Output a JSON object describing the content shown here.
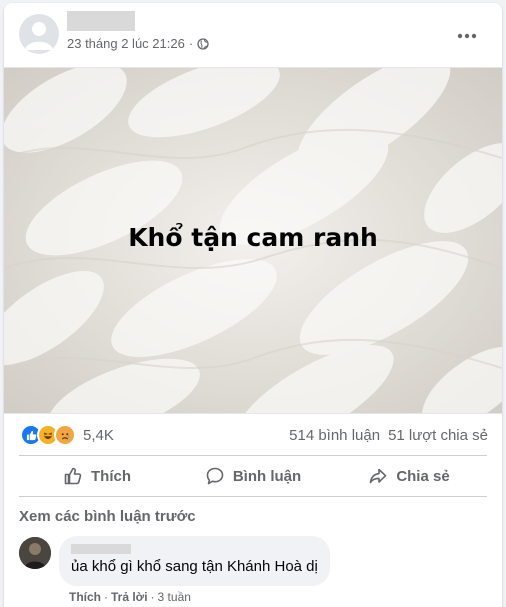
{
  "post": {
    "author_name": "",
    "timestamp": "23 tháng 2 lúc 21:26",
    "separator": "·",
    "privacy_icon": "globe-icon",
    "more_icon": "ellipsis-icon",
    "text": "Khổ tận cam ranh"
  },
  "stats": {
    "reaction_icons": [
      "like-icon",
      "haha-icon",
      "sad-icon"
    ],
    "reaction_count": "5,4K",
    "comments": "514 bình luận",
    "shares": "51 lượt chia sẻ"
  },
  "actions": {
    "like": "Thích",
    "comment": "Bình luận",
    "share": "Chia sẻ"
  },
  "comments_section": {
    "view_previous": "Xem các bình luận trước",
    "comment": {
      "author": "",
      "text": "ủa khổ gì khổ sang tận Khánh Hoà dị",
      "like": "Thích",
      "sep1": "·",
      "reply": "Trả lời",
      "sep2": "·",
      "time": "3 tuần"
    }
  },
  "colors": {
    "facebook_blue": "#1877f2",
    "secondary_text": "#65676b",
    "divider": "#ced0d4",
    "haha_yellow": "#f7b125",
    "sad_orange": "#f2a541"
  }
}
